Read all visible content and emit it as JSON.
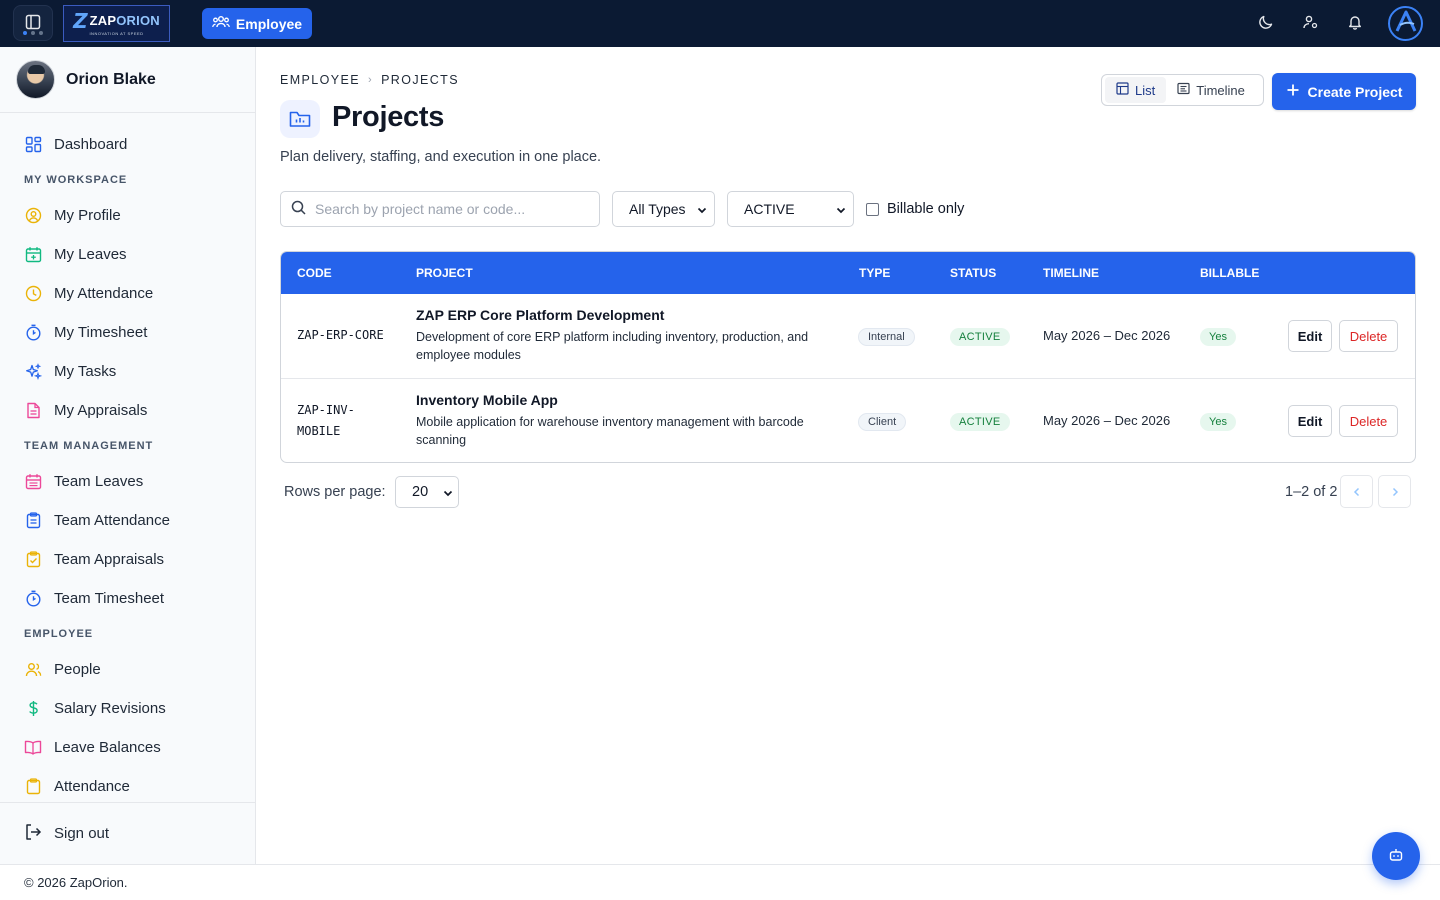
{
  "app": {
    "logo_text_a": "ZAP",
    "logo_text_b": "ORION",
    "logo_tagline": "INNOVATION AT SPEED",
    "module_label": "Employee",
    "accent_color": "#2563eb"
  },
  "topbar_icons": [
    "sidebar-toggle-icon",
    "moon-icon",
    "user-settings-icon",
    "bell-icon",
    "avatar-logo-icon"
  ],
  "user": {
    "name": "Orion Blake"
  },
  "sidebar": {
    "dashboard": "Dashboard",
    "sections": [
      {
        "title": "MY WORKSPACE",
        "items": [
          "My Profile",
          "My Leaves",
          "My Attendance",
          "My Timesheet",
          "My Tasks",
          "My Appraisals"
        ]
      },
      {
        "title": "TEAM MANAGEMENT",
        "items": [
          "Team Leaves",
          "Team Attendance",
          "Team Appraisals",
          "Team Timesheet"
        ]
      },
      {
        "title": "EMPLOYEE",
        "items": [
          "People",
          "Salary Revisions",
          "Leave Balances",
          "Attendance"
        ]
      }
    ],
    "sign_out": "Sign out"
  },
  "page": {
    "breadcrumb": [
      "EMPLOYEE",
      "PROJECTS"
    ],
    "title": "Projects",
    "subtitle": "Plan delivery, staffing, and execution in one place.",
    "view_list": "List",
    "view_timeline": "Timeline",
    "create_button": "Create Project"
  },
  "filters": {
    "search_placeholder": "Search by project name or code...",
    "type_value": "All Types",
    "status_value": "ACTIVE",
    "billable_label": "Billable only"
  },
  "table": {
    "headers": [
      "CODE",
      "PROJECT",
      "TYPE",
      "STATUS",
      "TIMELINE",
      "BILLABLE"
    ],
    "rows": [
      {
        "code": "ZAP-ERP-CORE",
        "name": "ZAP ERP Core Platform Development",
        "description": "Development of core ERP platform including inventory, production, and employee modules",
        "type": "Internal",
        "status": "ACTIVE",
        "timeline": "May 2026 – Dec 2026",
        "billable": "Yes",
        "edit": "Edit",
        "delete": "Delete"
      },
      {
        "code": "ZAP-INV-MOBILE",
        "name": "Inventory Mobile App",
        "description": "Mobile application for warehouse inventory management with barcode scanning",
        "type": "Client",
        "status": "ACTIVE",
        "timeline": "May 2026 – Dec 2026",
        "billable": "Yes",
        "edit": "Edit",
        "delete": "Delete"
      }
    ]
  },
  "pagination": {
    "rows_per_page_label": "Rows per page:",
    "rows_per_page": "20",
    "range": "1–2 of 2"
  },
  "footer": {
    "copyright": "© 2026 ZapOrion."
  }
}
